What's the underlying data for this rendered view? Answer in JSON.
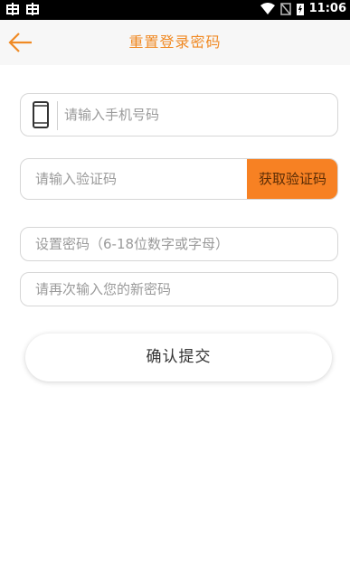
{
  "status_bar": {
    "left_icons": [
      "bug-icon",
      "bug-icon"
    ],
    "right_icons": [
      "wifi-icon",
      "no-sim-icon",
      "battery-icon"
    ],
    "time": "11:06"
  },
  "header": {
    "back_icon": "arrow-left-icon",
    "title": "重置登录密码"
  },
  "form": {
    "phone_placeholder": "请输入手机号码",
    "phone_icon": "smartphone-icon",
    "code_placeholder": "请输入验证码",
    "get_code_label": "获取验证码",
    "password_placeholder": "设置密码（6-18位数字或字母）",
    "confirm_password_placeholder": "请再次输入您的新密码",
    "submit_label": "确认提交"
  },
  "colors": {
    "accent": "#f08a24",
    "code_button": "#f78123",
    "header_bg": "#f7f7f7"
  }
}
